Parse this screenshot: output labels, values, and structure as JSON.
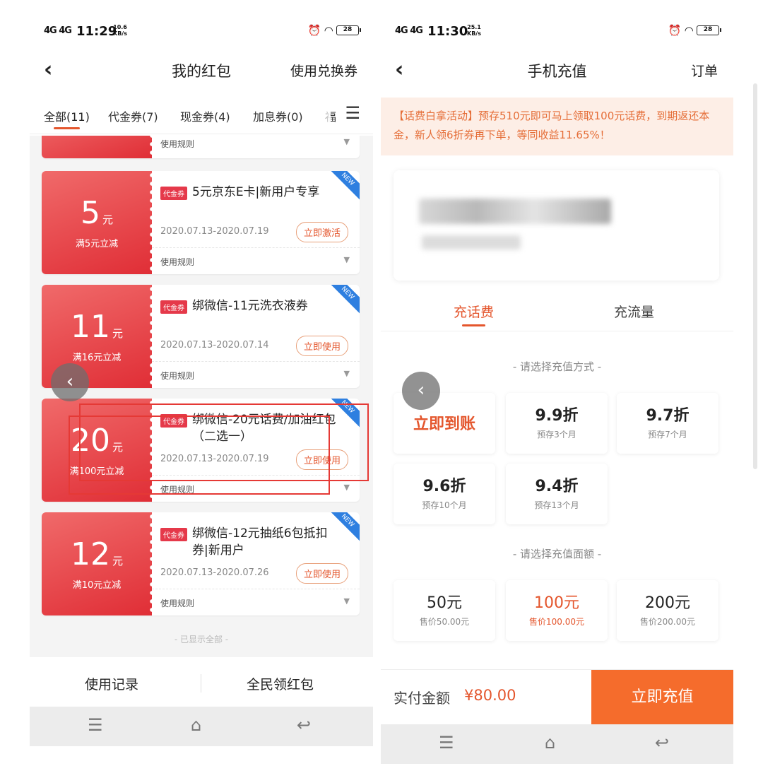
{
  "left": {
    "status": {
      "signal": "4G 4G",
      "time": "11:29",
      "speed": "10.6\nKB/s",
      "battery": "28"
    },
    "nav": {
      "back": "‹",
      "title": "我的红包",
      "right": "使用兑换券"
    },
    "tabs": [
      {
        "label": "全部(11)"
      },
      {
        "label": "代金券(7)"
      },
      {
        "label": "现金券(4)"
      },
      {
        "label": "加息券(0)"
      },
      {
        "label": "福"
      }
    ],
    "rules_label": "使用规则",
    "coupons": [
      {
        "amount": "5",
        "unit": "元",
        "condition": "满5元立减",
        "tag": "代金券",
        "name": "5元京东E卡|新用户专享",
        "date": "2020.07.13-2020.07.19",
        "action": "立即激活",
        "badge": "NEW"
      },
      {
        "amount": "11",
        "unit": "元",
        "condition": "满16元立减",
        "tag": "代金券",
        "name": "绑微信-11元洗衣液券",
        "date": "2020.07.13-2020.07.14",
        "action": "立即使用",
        "badge": "NEW"
      },
      {
        "amount": "20",
        "unit": "元",
        "condition": "满100元立减",
        "tag": "代金券",
        "name": "绑微信-20元话费/加油红包（二选一）",
        "date": "2020.07.13-2020.07.19",
        "action": "立即使用",
        "badge": "NEW"
      },
      {
        "amount": "12",
        "unit": "元",
        "condition": "满10元立减",
        "tag": "代金券",
        "name": "绑微信-12元抽纸6包抵扣券|新用户",
        "date": "2020.07.13-2020.07.26",
        "action": "立即使用",
        "badge": "NEW"
      }
    ],
    "end_text": "- 已显示全部 -",
    "bottom": {
      "records": "使用记录",
      "claim": "全民领红包"
    }
  },
  "right": {
    "status": {
      "signal": "4G 4G",
      "time": "11:30",
      "speed": "25.1\nKB/s",
      "battery": "28"
    },
    "nav": {
      "back": "‹",
      "title": "手机充值",
      "right": "订单"
    },
    "notice": "【话费白拿活动】预存510元即可马上领取100元话费，到期返还本金，新人领6折券再下单，等同收益11.65%！",
    "tabs": {
      "t1": "充话费",
      "t2": "充流量"
    },
    "method_title": "- 请选择充值方式 -",
    "methods": [
      {
        "big": "立即到账",
        "small": ""
      },
      {
        "big": "9.9折",
        "small": "预存3个月"
      },
      {
        "big": "9.7折",
        "small": "预存7个月"
      },
      {
        "big": "9.6折",
        "small": "预存10个月"
      },
      {
        "big": "9.4折",
        "small": "预存13个月"
      }
    ],
    "amount_title": "- 请选择充值面额 -",
    "amounts": [
      {
        "big": "50元",
        "small": "售价50.00元"
      },
      {
        "big": "100元",
        "small": "售价100.00元"
      },
      {
        "big": "200元",
        "small": "售价200.00元"
      }
    ],
    "pay": {
      "label": "实付金额",
      "value": "¥80.00",
      "button": "立即充值"
    }
  },
  "sysnav": {
    "menu": "☰",
    "home": "⌂",
    "back": "↩"
  },
  "colors": {
    "accent": "#e4562d",
    "coupon_red": "#e02e36",
    "pay_orange": "#f56c2c",
    "notice_bg": "#fdeee6",
    "highlight_box": "#e53935"
  }
}
